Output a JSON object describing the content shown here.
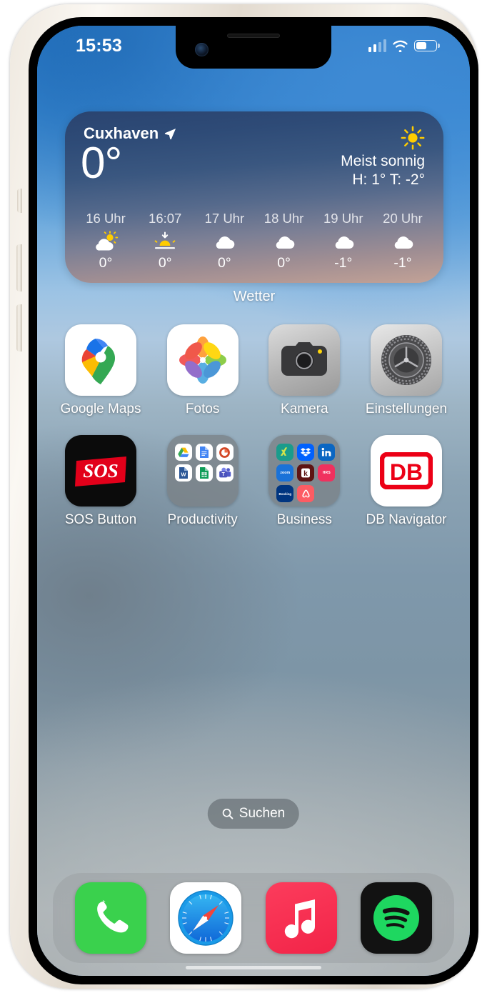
{
  "device": {
    "frame_color": "#f2ece3",
    "notch": {
      "camera_icon": "front-camera-icon",
      "speaker_icon": "earpiece-speaker-icon"
    }
  },
  "status_bar": {
    "time": "15:53",
    "signal_icon": "cellular-signal-icon",
    "signal_bars_filled": 2,
    "signal_bars_total": 4,
    "wifi_icon": "wifi-icon",
    "battery_icon": "battery-icon",
    "battery_percent": 55
  },
  "weather_widget": {
    "city": "Cuxhaven",
    "location_icon": "location-arrow-icon",
    "temperature": "0°",
    "condition_icon": "sun-icon",
    "condition": "Meist sonnig",
    "high_low": "H: 1° T: -2°",
    "widget_label": "Wetter",
    "hourly": [
      {
        "time": "16 Uhr",
        "icon": "partly-cloudy-icon",
        "temp": "0°"
      },
      {
        "time": "16:07",
        "icon": "sunset-icon",
        "temp": "0°"
      },
      {
        "time": "17 Uhr",
        "icon": "cloud-icon",
        "temp": "0°"
      },
      {
        "time": "18 Uhr",
        "icon": "cloud-icon",
        "temp": "0°"
      },
      {
        "time": "19 Uhr",
        "icon": "cloud-icon",
        "temp": "-1°"
      },
      {
        "time": "20 Uhr",
        "icon": "cloud-icon",
        "temp": "-1°"
      }
    ]
  },
  "home_screen": {
    "row1": [
      {
        "label": "Google Maps",
        "icon": "google-maps-icon"
      },
      {
        "label": "Fotos",
        "icon": "photos-icon"
      },
      {
        "label": "Kamera",
        "icon": "camera-icon"
      },
      {
        "label": "Einstellungen",
        "icon": "settings-gear-icon"
      }
    ],
    "row2": [
      {
        "label": "SOS Button",
        "icon": "sos-button-icon"
      },
      {
        "label": "Productivity",
        "icon": "folder-icon",
        "folder_apps": [
          "Google Drive",
          "Google Docs",
          "PowerPoint",
          "Word",
          "Google Sheets",
          "Teams"
        ]
      },
      {
        "label": "Business",
        "icon": "folder-icon",
        "folder_apps": [
          "Xing",
          "Dropbox",
          "LinkedIn",
          "Zoom",
          "kununu",
          "HRS",
          "Booking.com",
          "Airbnb"
        ]
      },
      {
        "label": "DB Navigator",
        "icon": "db-navigator-icon"
      }
    ]
  },
  "search": {
    "label": "Suchen",
    "icon": "search-icon"
  },
  "dock": [
    {
      "label": "Telefon",
      "icon": "phone-icon"
    },
    {
      "label": "Safari",
      "icon": "safari-compass-icon"
    },
    {
      "label": "Musik",
      "icon": "music-note-icon"
    },
    {
      "label": "Spotify",
      "icon": "spotify-icon"
    }
  ],
  "colors": {
    "wallpaper_top": "#2b7ac8",
    "wallpaper_bottom": "#9fa5a7",
    "widget_dark": "#2a4470",
    "widget_warm": "#c3a296",
    "accent_red": "#ec0016",
    "accent_green": "#1ed760"
  }
}
